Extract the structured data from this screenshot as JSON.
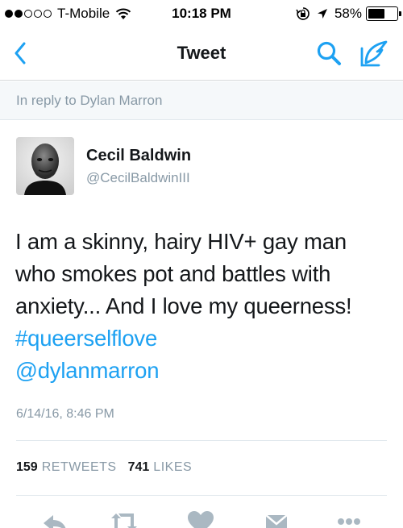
{
  "status_bar": {
    "signal_filled": 2,
    "signal_total": 5,
    "carrier": "T-Mobile",
    "time": "10:18 PM",
    "battery_percent_text": "58%",
    "battery_level": 0.58,
    "icons": [
      "wifi-icon",
      "rotation-lock-icon",
      "location-arrow-icon",
      "battery-icon"
    ]
  },
  "nav": {
    "title": "Tweet",
    "icons": [
      "chevron-left-icon",
      "search-icon",
      "compose-icon"
    ],
    "accent_color": "#1da1f2"
  },
  "reply_context": {
    "text": "In reply to Dylan Marron"
  },
  "tweet": {
    "author_name": "Cecil Baldwin",
    "author_handle": "@CecilBaldwinIII",
    "body_lines": [
      "I am a skinny, hairy HIV+ gay man",
      "who smokes  pot and battles with",
      "anxiety... And I love my queerness!"
    ],
    "hashtag": "#queerselflove",
    "mention": "@dylanmarron",
    "timestamp": "6/14/16, 8:46 PM"
  },
  "stats": {
    "retweets_count": "159",
    "retweets_label": "RETWEETS",
    "likes_count": "741",
    "likes_label": "LIKES"
  },
  "actions": [
    "reply-icon",
    "retweet-icon",
    "like-heart-icon",
    "message-envelope-icon",
    "more-dots-icon"
  ],
  "colors": {
    "link": "#1da1f2",
    "secondary_text": "#8899a6",
    "action_icon": "#aab8c2"
  }
}
